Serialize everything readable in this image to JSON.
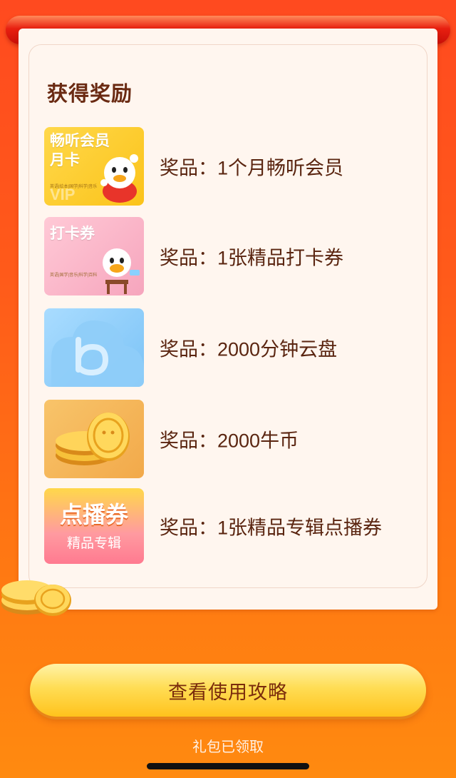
{
  "card": {
    "title": "获得奖励",
    "prizes": [
      {
        "thumb_title_line1": "畅听会员",
        "thumb_title_line2": "月卡",
        "thumb_caption": "英语|绘本|国学|科学|音乐",
        "thumb_mark": "VIP",
        "label": "奖品：1个月畅听会员"
      },
      {
        "thumb_title_line1": "打卡券",
        "thumb_caption": "英语|国学|音乐|科学|百科",
        "label": "奖品：1张精品打卡券"
      },
      {
        "label": "奖品：2000分钟云盘"
      },
      {
        "label": "奖品：2000牛币"
      },
      {
        "thumb_big": "点播券",
        "thumb_small": "精品专辑",
        "label": "奖品：1张精品专辑点播券"
      }
    ]
  },
  "cta": {
    "label": "查看使用攻略"
  },
  "status": {
    "text": "礼包已领取"
  },
  "colors": {
    "background": "#ff5a1a",
    "card": "#fff6ef",
    "title": "#6a2a12",
    "button": "#ffd84a",
    "button_text": "#7a2c0c"
  }
}
